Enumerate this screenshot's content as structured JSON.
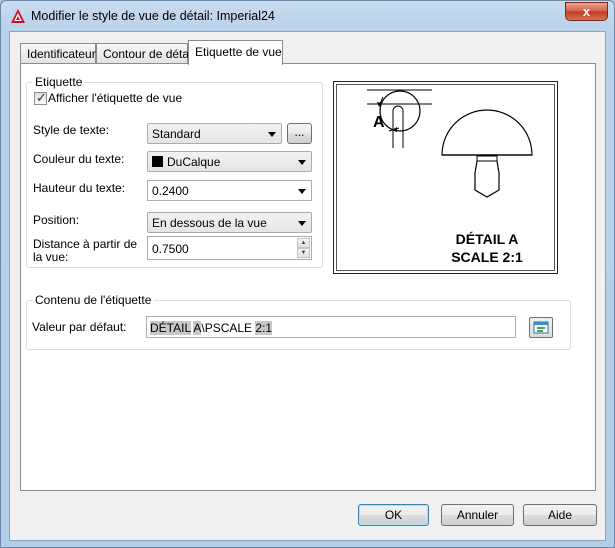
{
  "window": {
    "title": "Modifier le style de vue de détail: Imperial24",
    "close_glyph": "x"
  },
  "tabs": [
    {
      "label": "Identificateur"
    },
    {
      "label": "Contour de détail"
    },
    {
      "label": "Etiquette de vue"
    }
  ],
  "label_group": {
    "title": "Etiquette",
    "show_label": {
      "label": "Afficher l'étiquette de vue",
      "checked": true
    },
    "text_style": {
      "label": "Style de texte:",
      "value": "Standard",
      "browse_label": "..."
    },
    "text_color": {
      "label": "Couleur du texte:",
      "value": "DuCalque",
      "swatch_color": "#000000"
    },
    "text_height": {
      "label": "Hauteur du texte:",
      "value": "0.2400"
    },
    "position": {
      "label": "Position:",
      "value": "En dessous de la vue"
    },
    "distance": {
      "label_line1": "Distance à partir de",
      "label_line2": "la vue:",
      "value": "0.7500"
    }
  },
  "preview": {
    "callout_letter": "A",
    "label_line1": "DÉTAIL A",
    "label_line2": "SCALE 2:1"
  },
  "content_group": {
    "title": "Contenu de l'étiquette",
    "default_label": "Valeur par défaut:",
    "default_value": {
      "part1": "DÉTAIL",
      "part2": " ",
      "part3": "A",
      "part4": "\\PSCALE ",
      "part5": "2:1"
    },
    "field_icon": "insert-field-icon"
  },
  "buttons": {
    "ok": "OK",
    "cancel": "Annuler",
    "help": "Aide"
  }
}
